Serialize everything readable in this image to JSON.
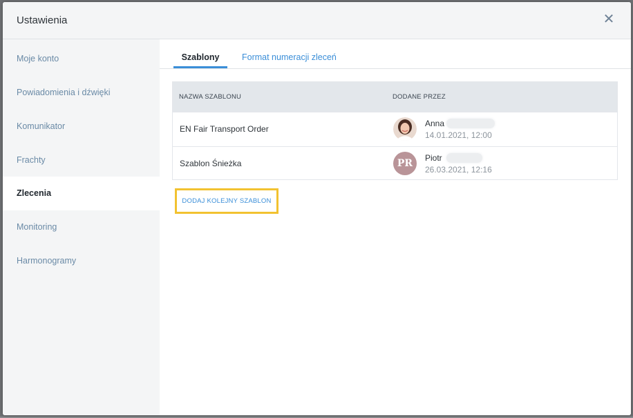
{
  "modal": {
    "title": "Ustawienia",
    "close_symbol": "✕"
  },
  "sidebar": {
    "items": [
      {
        "label": "Moje konto"
      },
      {
        "label": "Powiadomienia i dźwięki"
      },
      {
        "label": "Komunikator"
      },
      {
        "label": "Frachty"
      },
      {
        "label": "Zlecenia",
        "active": true
      },
      {
        "label": "Monitoring"
      },
      {
        "label": "Harmonogramy"
      }
    ]
  },
  "tabs": [
    {
      "label": "Szablony",
      "active": true
    },
    {
      "label": "Format numeracji zleceń"
    }
  ],
  "table": {
    "headers": [
      "NAZWA SZABLONU",
      "DODANE PRZEZ"
    ],
    "rows": [
      {
        "name": "EN Fair Transport Order",
        "user": "Anna",
        "date": "14.01.2021, 12:00",
        "avatar": "photo"
      },
      {
        "name": "Szablon Śnieżka",
        "user": "Piotr",
        "date": "26.03.2021, 12:16",
        "avatar": "PR"
      }
    ]
  },
  "add_button": {
    "label": "DODAJ KOLEJNY SZABLON"
  },
  "colors": {
    "accent": "#3a8ed8",
    "highlight": "#f2c230",
    "avatar_initials_bg": "#b99498"
  }
}
